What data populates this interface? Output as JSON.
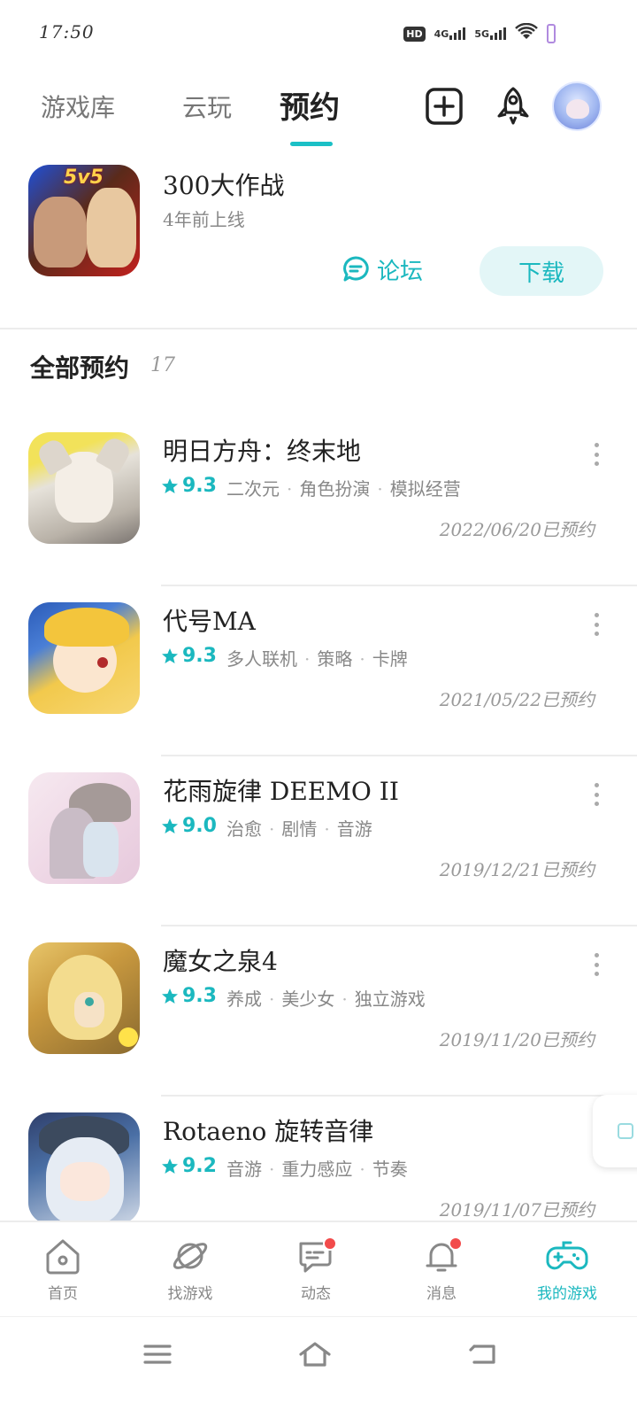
{
  "status_bar": {
    "time": "17:50",
    "hd": "HD",
    "net1": "4G",
    "net2": "5G"
  },
  "top_tabs": {
    "library": "游戏库",
    "cloud": "云玩",
    "reserve": "预约"
  },
  "featured": {
    "badge": "5v5",
    "title": "300大作战",
    "subtitle": "4年前上线",
    "forum_label": "论坛",
    "download_label": "下载"
  },
  "section": {
    "title": "全部预约",
    "count": "17"
  },
  "games": [
    {
      "name": "明日方舟：终末地",
      "rating": "9.3",
      "tags": [
        "二次元",
        "角色扮演",
        "模拟经营"
      ],
      "date": "2022/06/20已预约"
    },
    {
      "name": "代号MA",
      "rating": "9.3",
      "tags": [
        "多人联机",
        "策略",
        "卡牌"
      ],
      "date": "2021/05/22已预约"
    },
    {
      "name": "花雨旋律 DEEMO II",
      "rating": "9.0",
      "tags": [
        "治愈",
        "剧情",
        "音游"
      ],
      "date": "2019/12/21已预约"
    },
    {
      "name": "魔女之泉4",
      "rating": "9.3",
      "tags": [
        "养成",
        "美少女",
        "独立游戏"
      ],
      "date": "2019/11/20已预约"
    },
    {
      "name": "Rotaeno 旋转音律",
      "rating": "9.2",
      "tags": [
        "音游",
        "重力感应",
        "节奏"
      ],
      "date": "2019/11/07已预约"
    }
  ],
  "bottom_nav": {
    "home": "首页",
    "find": "找游戏",
    "moments": "动态",
    "messages": "消息",
    "my_games": "我的游戏"
  },
  "colors": {
    "accent": "#1bb8bf",
    "badge_red": "#f24b4b"
  }
}
